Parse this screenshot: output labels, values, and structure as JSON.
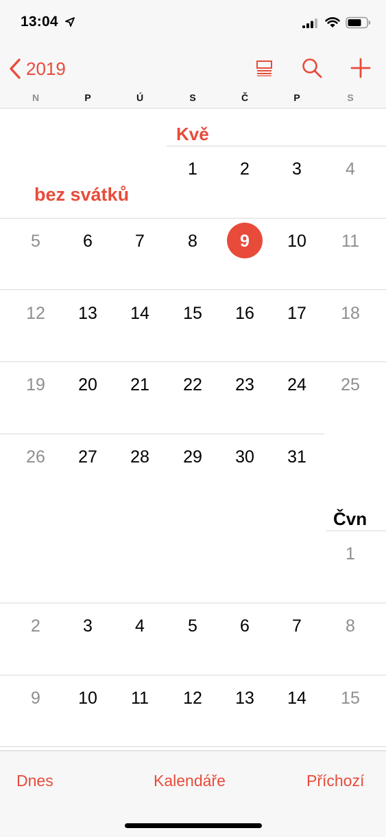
{
  "status_bar": {
    "time": "13:04"
  },
  "nav": {
    "back_label": "2019"
  },
  "weekdays": [
    "N",
    "P",
    "Ú",
    "S",
    "Č",
    "P",
    "S"
  ],
  "may": {
    "month_label": "Kvě",
    "holiday_label": "bez svátků",
    "rows": [
      [
        "",
        "",
        "",
        "1",
        "2",
        "3",
        "4"
      ],
      [
        "5",
        "6",
        "7",
        "8",
        "9",
        "10",
        "11"
      ],
      [
        "12",
        "13",
        "14",
        "15",
        "16",
        "17",
        "18"
      ],
      [
        "19",
        "20",
        "21",
        "22",
        "23",
        "24",
        "25"
      ],
      [
        "26",
        "27",
        "28",
        "29",
        "30",
        "31",
        ""
      ]
    ],
    "today": "9"
  },
  "june": {
    "month_label": "Čvn",
    "rows": [
      [
        "",
        "",
        "",
        "",
        "",
        "",
        "1"
      ],
      [
        "2",
        "3",
        "4",
        "5",
        "6",
        "7",
        "8"
      ],
      [
        "9",
        "10",
        "11",
        "12",
        "13",
        "14",
        "15"
      ]
    ]
  },
  "tab_bar": {
    "today": "Dnes",
    "calendars": "Kalendáře",
    "inbox": "Příchozí"
  },
  "colors": {
    "accent": "#e84b3a",
    "weekend": "#8e8e93",
    "bars": "#f7f7f7"
  },
  "icons": [
    "location-arrow-icon",
    "cellular-signal-icon",
    "wifi-icon",
    "battery-icon",
    "chevron-left-icon",
    "list-view-icon",
    "search-icon",
    "add-icon"
  ]
}
